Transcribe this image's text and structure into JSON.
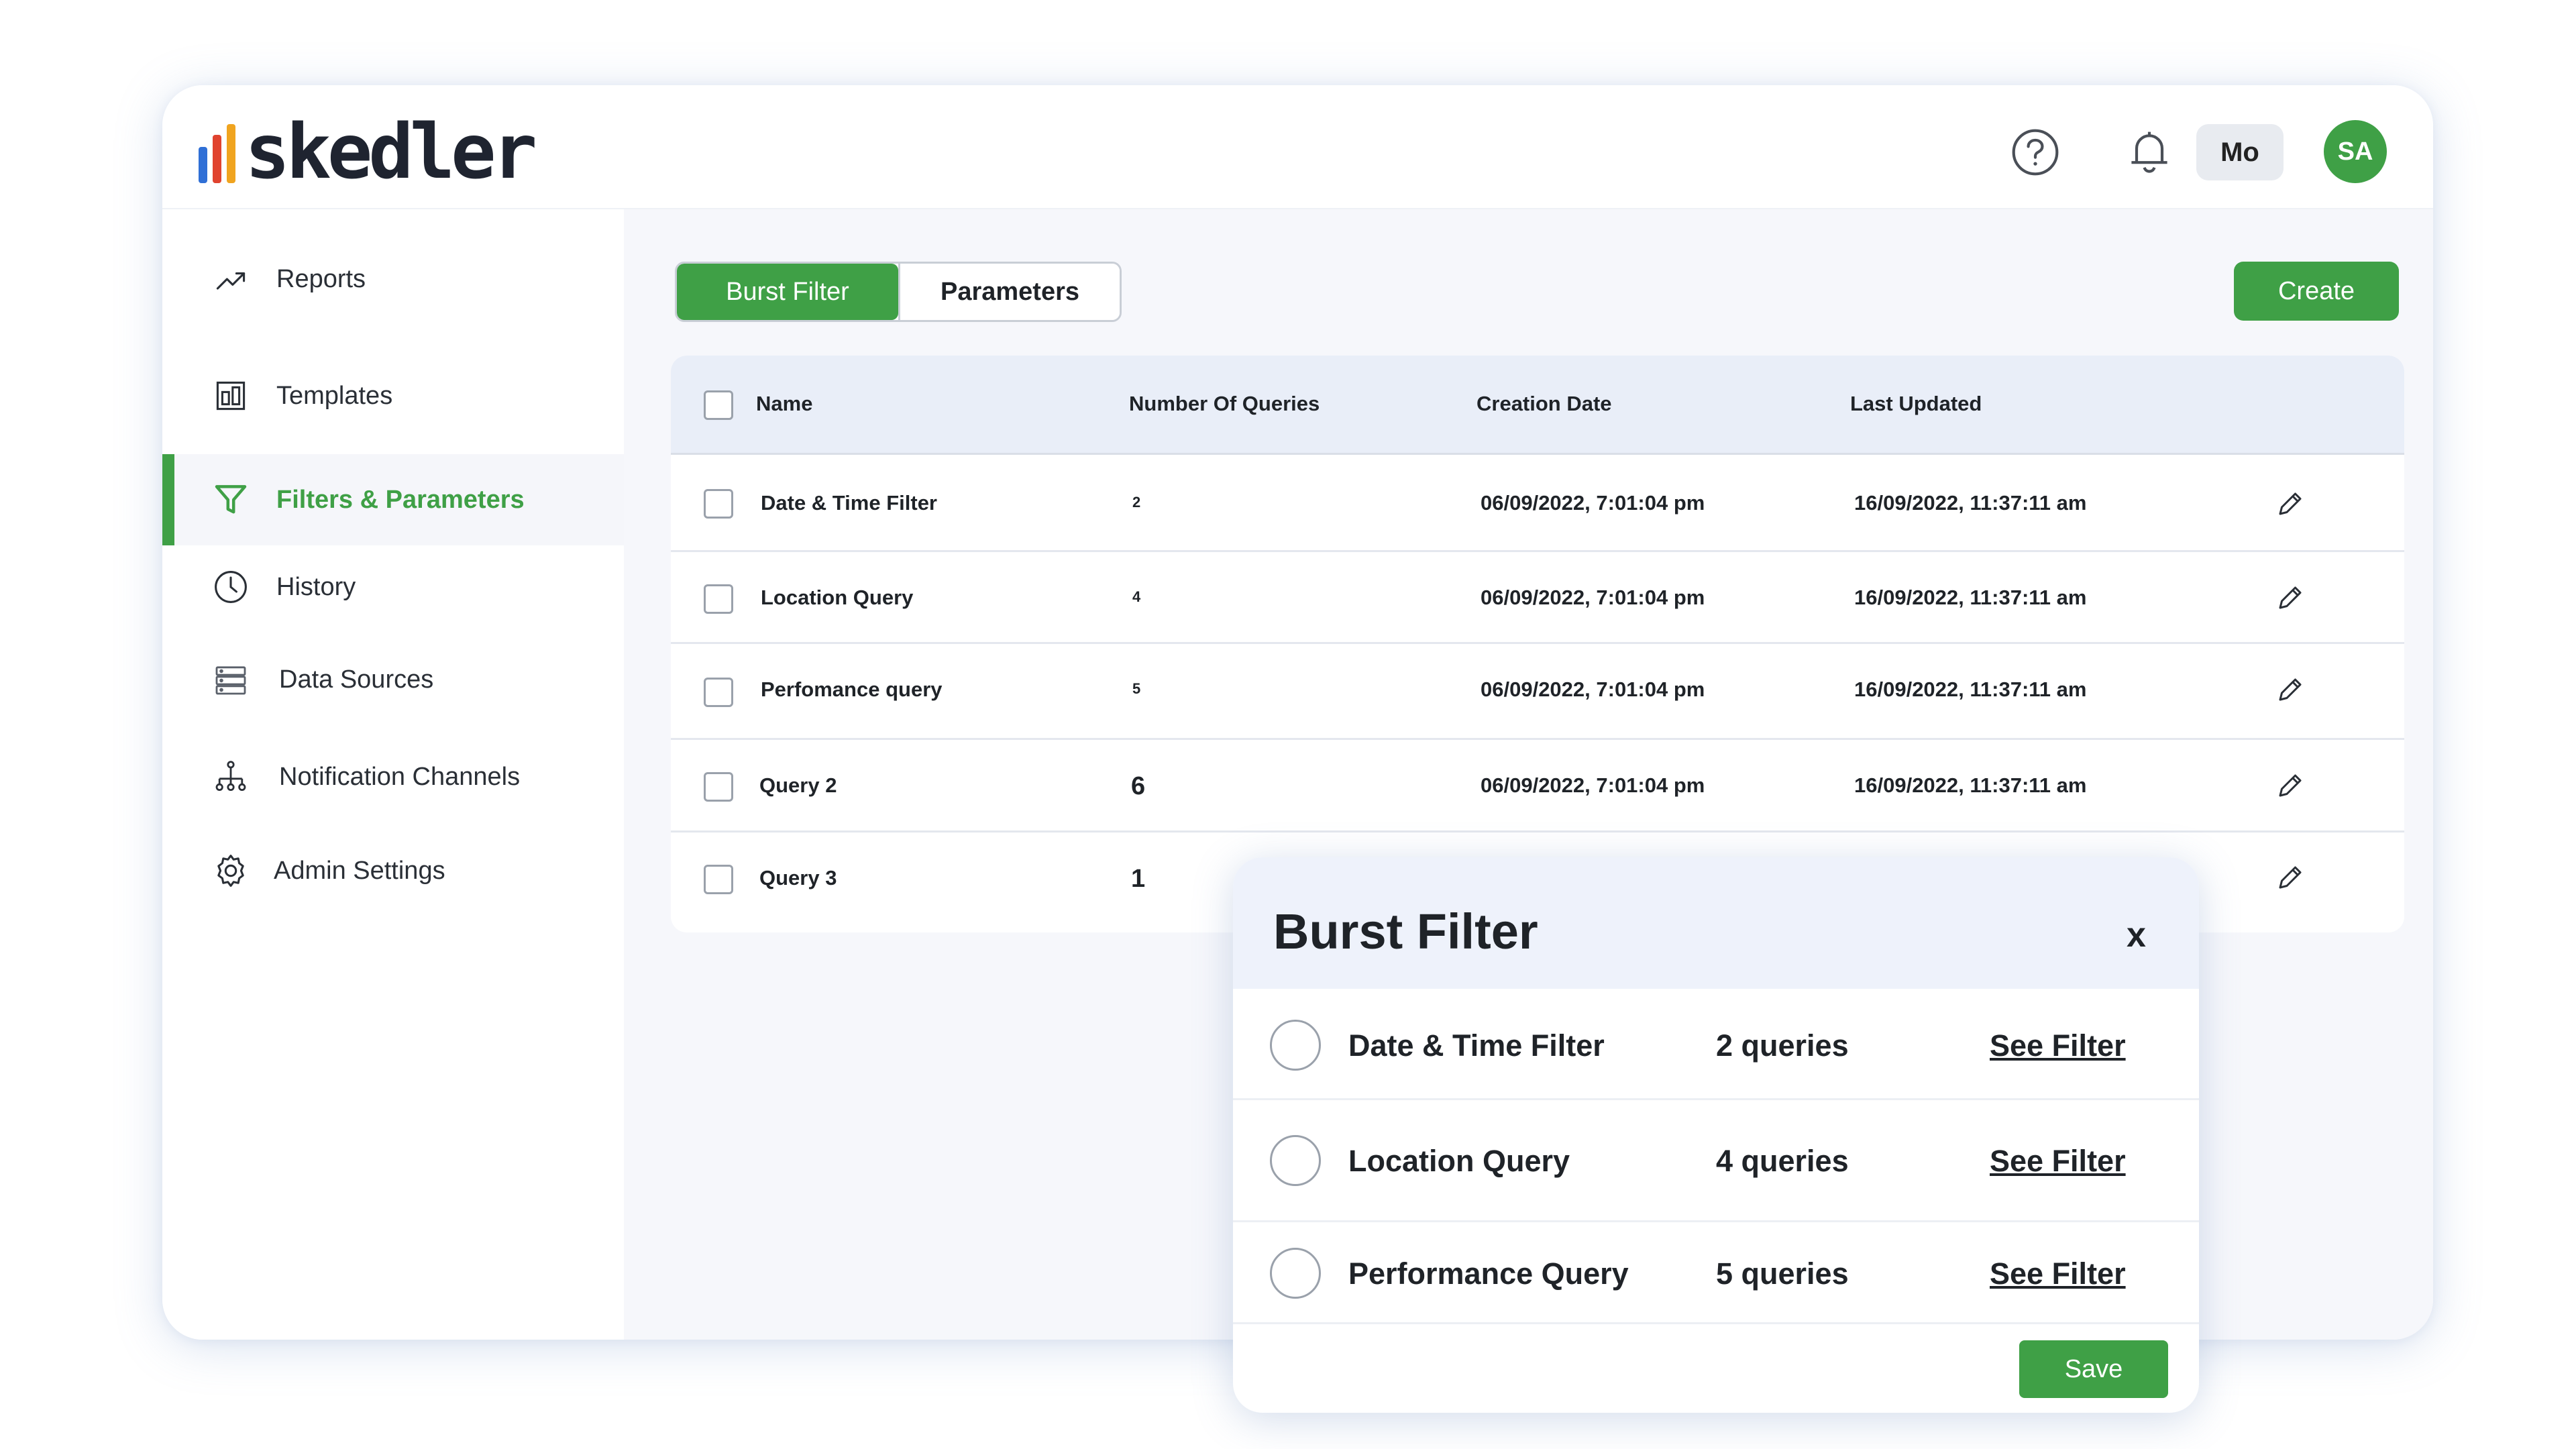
{
  "brand": {
    "logo_text": "skedler",
    "bar_colors": [
      "#2f6fd6",
      "#e0432f",
      "#f0a41f"
    ],
    "accent": "#3fa046"
  },
  "header": {
    "help_icon": "help-circle-icon",
    "bell_icon": "bell-icon",
    "lang_label": "Mo",
    "avatar_initials": "SA"
  },
  "sidebar": {
    "items": [
      {
        "label": "Reports",
        "icon": "trend-chart-icon"
      },
      {
        "label": "Templates",
        "icon": "template-layout-icon"
      },
      {
        "label": "Filters & Parameters",
        "icon": "filter-funnel-icon",
        "active": true
      },
      {
        "label": "History",
        "icon": "clock-icon"
      },
      {
        "label": "Data Sources",
        "icon": "database-icon"
      },
      {
        "label": "Notification Channels",
        "icon": "network-tree-icon"
      },
      {
        "label": "Admin Settings",
        "icon": "gear-icon"
      }
    ]
  },
  "tabs": {
    "burst_filter": "Burst Filter",
    "parameters": "Parameters"
  },
  "create_label": "Create",
  "table": {
    "headers": {
      "name": "Name",
      "queries": "Number Of Queries",
      "created": "Creation Date",
      "updated": "Last Updated"
    },
    "rows": [
      {
        "name": "Date & Time Filter",
        "queries": "2",
        "created": "06/09/2022, 7:01:04 pm",
        "updated": "16/09/2022, 11:37:11 am"
      },
      {
        "name": "Location Query",
        "queries": "4",
        "created": "06/09/2022, 7:01:04 pm",
        "updated": "16/09/2022, 11:37:11 am"
      },
      {
        "name": "Perfomance query",
        "queries": "5",
        "created": "06/09/2022, 7:01:04 pm",
        "updated": "16/09/2022, 11:37:11 am"
      },
      {
        "name": "Query 2",
        "queries": "6",
        "created": "06/09/2022, 7:01:04 pm",
        "updated": "16/09/2022, 11:37:11 am"
      },
      {
        "name": "Query 3",
        "queries": "1",
        "created": "",
        "updated": ""
      }
    ]
  },
  "modal": {
    "title": "Burst Filter",
    "close_label": "x",
    "items": [
      {
        "name": "Date & Time Filter",
        "count": "2 queries",
        "link": "See Filter"
      },
      {
        "name": "Location Query",
        "count": "4 queries",
        "link": "See Filter"
      },
      {
        "name": "Performance Query",
        "count": "5 queries",
        "link": "See Filter"
      }
    ],
    "save_label": "Save"
  }
}
